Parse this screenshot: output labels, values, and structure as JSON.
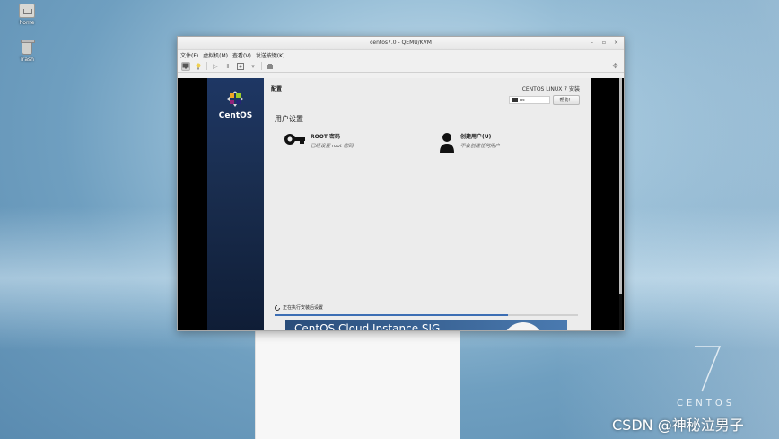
{
  "desktop": {
    "icons": [
      {
        "label": "home"
      },
      {
        "label": "Trash"
      }
    ],
    "watermark": {
      "version": "7",
      "brand": "CENTOS"
    },
    "credit": "CSDN @神秘泣男子"
  },
  "vm": {
    "title": "centos7.0 - QEMU/KVM",
    "window_controls": {
      "minimize": "–",
      "maximize": "▫",
      "close": "×"
    },
    "menu": [
      "文件(F)",
      "虚拟机(M)",
      "查看(V)",
      "发送按键(K)"
    ],
    "toolbar_icons": [
      "monitor-icon",
      "lightbulb-icon",
      "play-icon",
      "pause-icon",
      "power-icon",
      "dropdown-icon",
      "screenshot-icon"
    ],
    "fullscreen_icon": "resize-icon"
  },
  "installer": {
    "logo_text": "CentOS",
    "page_title": "配置",
    "os_title": "CENTOS LINUX 7 安装",
    "keyboard_layout": "us",
    "help_label": "帮助！",
    "section_title": "用户设置",
    "spokes": [
      {
        "name": "ROOT 密码",
        "status": "已经设置 root 密码",
        "icon": "key-icon"
      },
      {
        "name": "创建用户(U)",
        "status": "不会创建任何用户",
        "icon": "user-icon"
      }
    ],
    "progress": {
      "label": "正在执行安装后设置",
      "fraction": 0.77
    },
    "banner_text": "CentOS Cloud Instance SIG"
  },
  "colors": {
    "accent": "#3c6eb4",
    "sidebar": "#1e3764"
  }
}
